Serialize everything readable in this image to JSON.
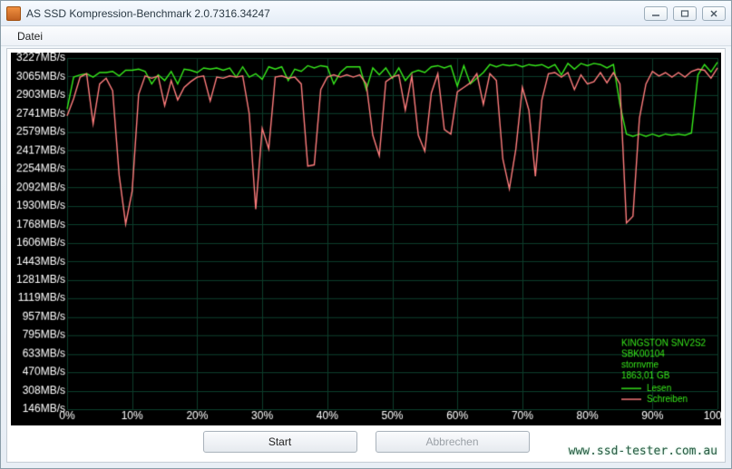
{
  "window": {
    "title": "AS SSD Kompression-Benchmark 2.0.7316.34247"
  },
  "menu": {
    "file": "Datei"
  },
  "buttons": {
    "start": "Start",
    "abort": "Abbrechen"
  },
  "drive_info": {
    "model": "KINGSTON SNV2S2",
    "firmware": "SBK00104",
    "driver": "stornvme",
    "capacity": "1863,01 GB"
  },
  "legend": {
    "read": "Lesen",
    "write": "Schreiben"
  },
  "watermark": "www.ssd-tester.com.au",
  "chart_data": {
    "type": "line",
    "xlabel": "",
    "ylabel": "",
    "x_unit": "%",
    "y_unit": "MB/s",
    "xlim": [
      0,
      100
    ],
    "ylim": [
      146,
      3227
    ],
    "y_ticks": [
      146,
      308,
      470,
      633,
      795,
      957,
      1119,
      1281,
      1443,
      1606,
      1768,
      1930,
      2092,
      2254,
      2417,
      2579,
      2741,
      2903,
      3065,
      3227
    ],
    "x_ticks": [
      0,
      10,
      20,
      30,
      40,
      50,
      60,
      70,
      80,
      90,
      100
    ],
    "series": [
      {
        "name": "Lesen",
        "color": "#37e81c",
        "values": [
          2780,
          3060,
          3080,
          3090,
          3060,
          3100,
          3100,
          3110,
          3070,
          3120,
          3120,
          3130,
          3110,
          3000,
          3080,
          3030,
          3110,
          3000,
          3130,
          3120,
          3100,
          3140,
          3130,
          3140,
          3120,
          3140,
          3060,
          3150,
          3060,
          3090,
          3040,
          3150,
          3130,
          3150,
          3030,
          3130,
          3110,
          3160,
          3140,
          3160,
          3150,
          3000,
          3100,
          3150,
          3150,
          3150,
          2950,
          3140,
          3080,
          3140,
          3050,
          3140,
          3030,
          3100,
          3120,
          3100,
          3150,
          3160,
          3140,
          3160,
          2980,
          3160,
          3000,
          3050,
          3100,
          3170,
          3150,
          3170,
          3160,
          3170,
          3150,
          3170,
          3160,
          3170,
          3140,
          3170,
          3080,
          3180,
          3130,
          3180,
          3160,
          3180,
          3170,
          3140,
          3170,
          2820,
          2560,
          2540,
          2560,
          2540,
          2560,
          2540,
          2560,
          2550,
          2560,
          2550,
          2570,
          3080,
          3170,
          3105,
          3190
        ]
      },
      {
        "name": "Schreiben",
        "color": "#ff7d7d",
        "values": [
          2720,
          2870,
          3060,
          3090,
          2650,
          3000,
          3050,
          2940,
          2200,
          1770,
          2060,
          2910,
          3070,
          3050,
          3070,
          2810,
          3030,
          2860,
          2970,
          3020,
          3060,
          3070,
          2850,
          3060,
          3050,
          3070,
          3060,
          3070,
          2740,
          1900,
          2610,
          2430,
          3060,
          3070,
          3050,
          3060,
          3000,
          2280,
          2290,
          2950,
          3060,
          3080,
          3060,
          3080,
          3060,
          3080,
          3000,
          2550,
          2370,
          3020,
          3060,
          3080,
          2770,
          3070,
          2550,
          2410,
          2920,
          3090,
          2600,
          2560,
          2930,
          2970,
          3010,
          3090,
          2820,
          3090,
          3030,
          2340,
          2080,
          2430,
          2970,
          2770,
          2190,
          2860,
          3090,
          3100,
          3060,
          3100,
          2950,
          3080,
          3000,
          3020,
          3100,
          3010,
          3100,
          3000,
          1780,
          1840,
          2700,
          3000,
          3110,
          3070,
          3100,
          3060,
          3100,
          3060,
          3110,
          3130,
          3120,
          3050,
          3140
        ]
      }
    ]
  }
}
